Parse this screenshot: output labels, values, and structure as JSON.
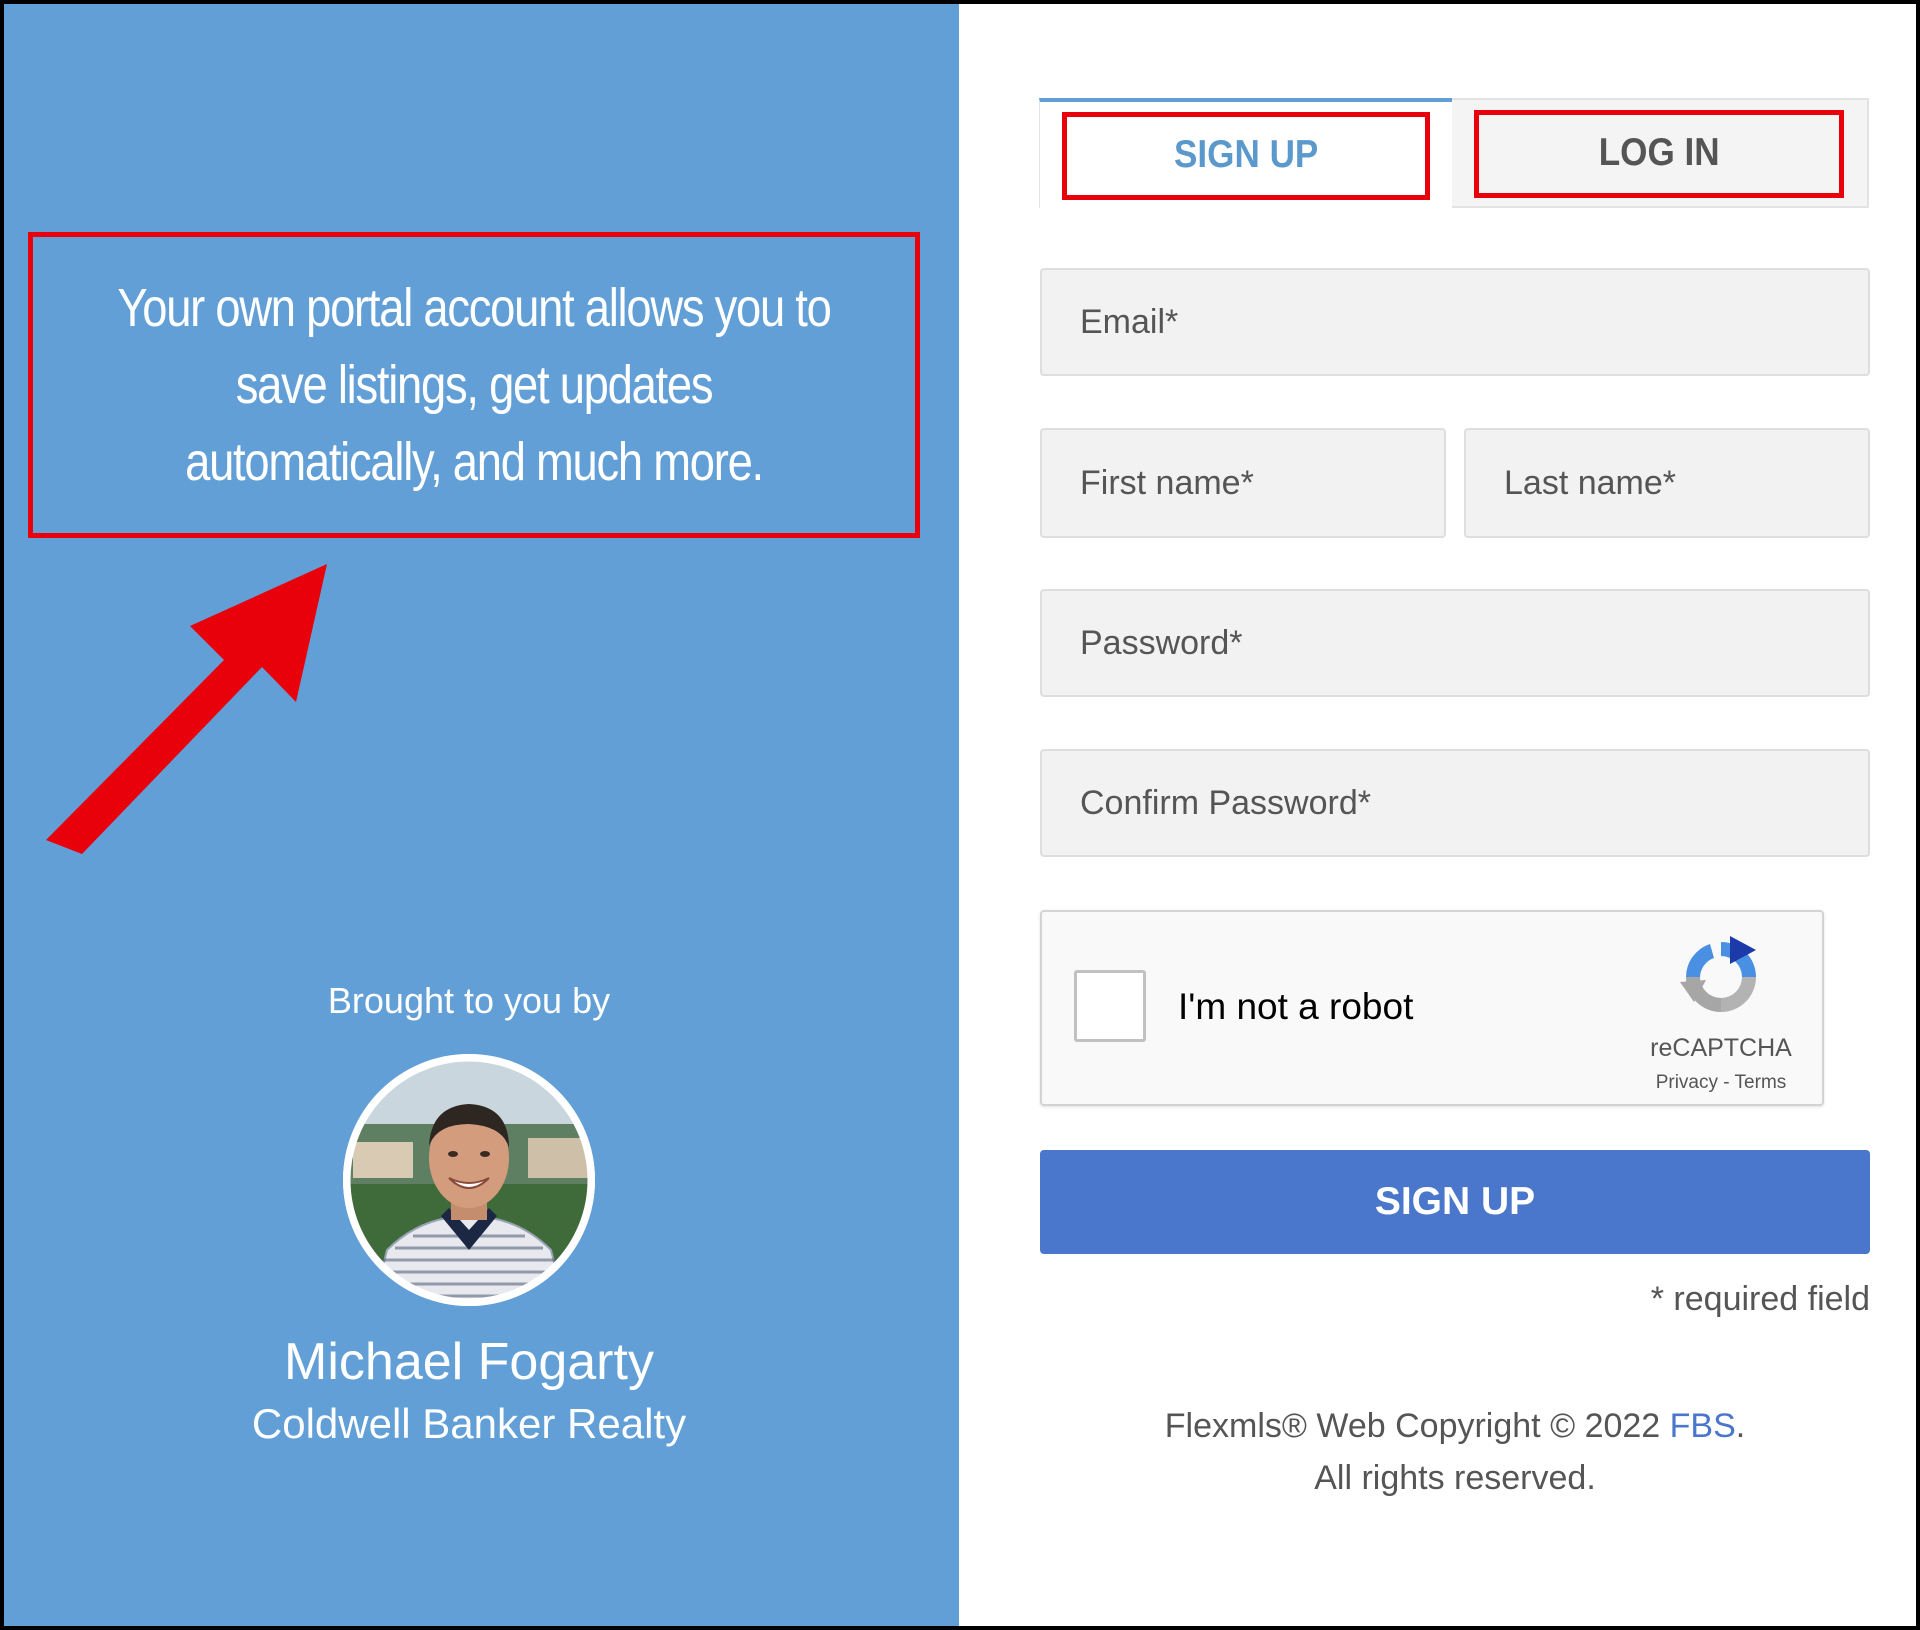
{
  "colors": {
    "left_panel_bg": "#629fd6",
    "highlight_red": "#e8000b",
    "primary_button": "#4a76cb",
    "link": "#4a76cb"
  },
  "promo": {
    "tagline": "Your own portal account allows you to save listings, get updates automatically, and much more."
  },
  "agent": {
    "intro": "Brought to you by",
    "name": "Michael Fogarty",
    "company": "Coldwell Banker Realty",
    "photo_icon": "agent-photo"
  },
  "tabs": [
    {
      "label": "SIGN UP",
      "active": true
    },
    {
      "label": "LOG IN",
      "active": false
    }
  ],
  "form": {
    "email_placeholder": "Email*",
    "first_name_placeholder": "First name*",
    "last_name_placeholder": "Last name*",
    "password_placeholder": "Password*",
    "confirm_password_placeholder": "Confirm Password*",
    "submit_label": "SIGN UP",
    "required_note": "* required field"
  },
  "captcha": {
    "label": "I'm not a robot",
    "brand": "reCAPTCHA",
    "privacy": "Privacy",
    "separator": "-",
    "terms": "Terms",
    "icon": "recaptcha-icon"
  },
  "footer": {
    "copyright_prefix": "Flexmls® Web Copyright © 2022 ",
    "fbs_link": "FBS",
    "copyright_suffix": ".",
    "rights": "All rights reserved."
  }
}
